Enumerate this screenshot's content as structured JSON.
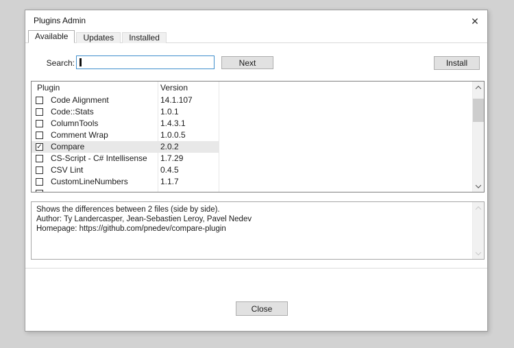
{
  "window": {
    "title": "Plugins Admin",
    "close_glyph": "✕"
  },
  "tabs": [
    {
      "label": "Available",
      "active": true
    },
    {
      "label": "Updates",
      "active": false
    },
    {
      "label": "Installed",
      "active": false
    }
  ],
  "search": {
    "label": "Search:",
    "value": "",
    "next_label": "Next"
  },
  "actions": {
    "install_label": "Install"
  },
  "plugin_list": {
    "columns": [
      "Plugin",
      "Version"
    ],
    "rows": [
      {
        "name": "Code Alignment",
        "version": "14.1.107",
        "checked": false,
        "selected": false
      },
      {
        "name": "Code::Stats",
        "version": "1.0.1",
        "checked": false,
        "selected": false
      },
      {
        "name": "ColumnTools",
        "version": "1.4.3.1",
        "checked": false,
        "selected": false
      },
      {
        "name": "Comment Wrap",
        "version": "1.0.0.5",
        "checked": false,
        "selected": false
      },
      {
        "name": "Compare",
        "version": "2.0.2",
        "checked": true,
        "selected": true
      },
      {
        "name": "CS-Script - C# Intellisense",
        "version": "1.7.29",
        "checked": false,
        "selected": false
      },
      {
        "name": "CSV Lint",
        "version": "0.4.5",
        "checked": false,
        "selected": false
      },
      {
        "name": "CustomLineNumbers",
        "version": "1.1.7",
        "checked": false,
        "selected": false
      },
      {
        "name": "",
        "version": "",
        "checked": false,
        "selected": false,
        "partial": true
      }
    ]
  },
  "description": {
    "lines": [
      "Shows the differences between 2 files (side by side).",
      "Author: Ty Landercasper, Jean-Sebastien Leroy, Pavel Nedev",
      "Homepage: https://github.com/pnedev/compare-plugin"
    ]
  },
  "footer": {
    "close_label": "Close"
  },
  "colors": {
    "desktop_bg": "#d2d2d2",
    "dialog_bg": "#ffffff",
    "dialog_border": "#9b9b9b",
    "focus_border": "#3f8ecc",
    "selection_bg": "#e8e8e8",
    "button_bg": "#e1e1e1",
    "button_border": "#adadad",
    "scrollbar_track": "#f1f1f1",
    "scrollbar_thumb": "#cdcdcd"
  }
}
